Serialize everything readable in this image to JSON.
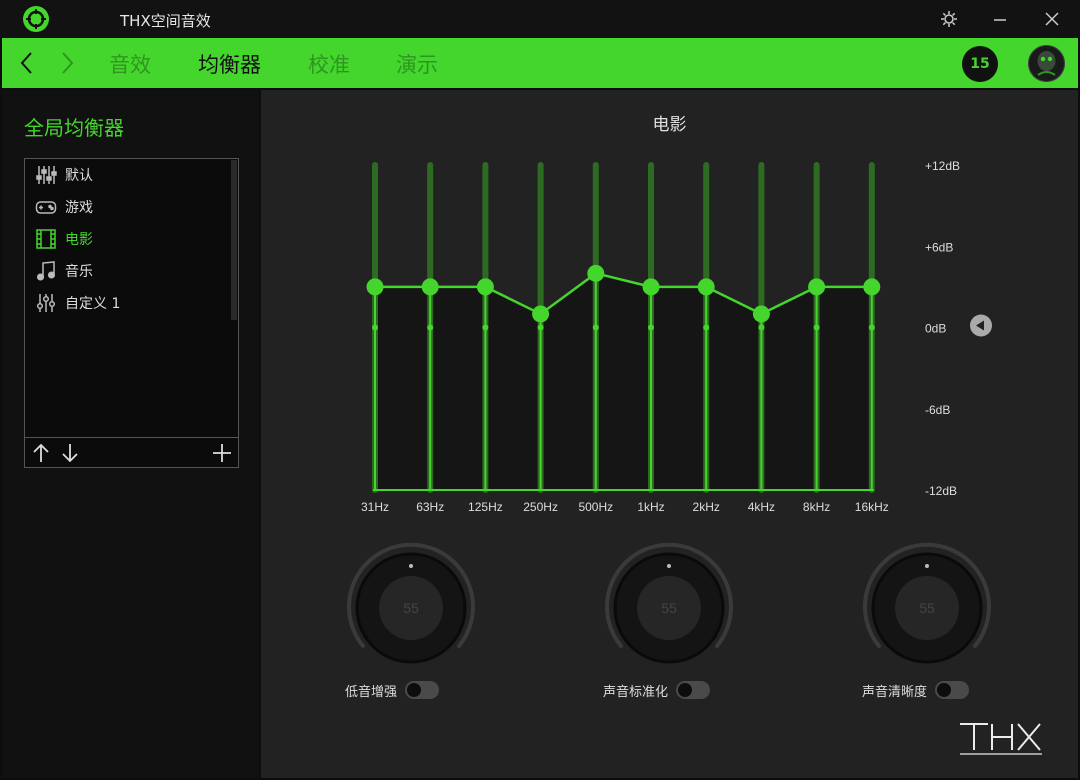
{
  "window": {
    "title": "THX空间音效",
    "icons": [
      "razer-logo-icon",
      "settings-icon",
      "minimize-icon",
      "close-icon"
    ]
  },
  "nav": {
    "tabs": [
      {
        "label": "音效",
        "active": false
      },
      {
        "label": "均衡器",
        "active": true
      },
      {
        "label": "校准",
        "active": false
      },
      {
        "label": "演示",
        "active": false
      }
    ],
    "badge": "15",
    "accent_color": "#44d62c"
  },
  "sidebar": {
    "title": "全局均衡器",
    "presets": [
      {
        "label": "默认",
        "icon": "sliders-icon",
        "active": false
      },
      {
        "label": "游戏",
        "icon": "gamepad-icon",
        "active": false
      },
      {
        "label": "电影",
        "icon": "film-icon",
        "active": true
      },
      {
        "label": "音乐",
        "icon": "music-note-icon",
        "active": false
      },
      {
        "label": "自定义 1",
        "icon": "custom-sliders-icon",
        "active": false
      }
    ]
  },
  "equalizer": {
    "title": "电影",
    "y_labels": [
      "+12dB",
      "+6dB",
      "0dB",
      "-6dB",
      "-12dB"
    ],
    "bands": [
      {
        "freq": "31Hz",
        "gain": 3
      },
      {
        "freq": "63Hz",
        "gain": 3
      },
      {
        "freq": "125Hz",
        "gain": 3
      },
      {
        "freq": "250Hz",
        "gain": 1
      },
      {
        "freq": "500Hz",
        "gain": 4
      },
      {
        "freq": "1kHz",
        "gain": 3
      },
      {
        "freq": "2kHz",
        "gain": 3
      },
      {
        "freq": "4kHz",
        "gain": 1
      },
      {
        "freq": "8kHz",
        "gain": 3
      },
      {
        "freq": "16kHz",
        "gain": 3
      }
    ],
    "range": [
      -12,
      12
    ]
  },
  "controls": [
    {
      "label": "低音增强",
      "value": "55",
      "enabled": false
    },
    {
      "label": "声音标准化",
      "value": "55",
      "enabled": false
    },
    {
      "label": "声音清晰度",
      "value": "55",
      "enabled": false
    }
  ],
  "brand": "THX"
}
